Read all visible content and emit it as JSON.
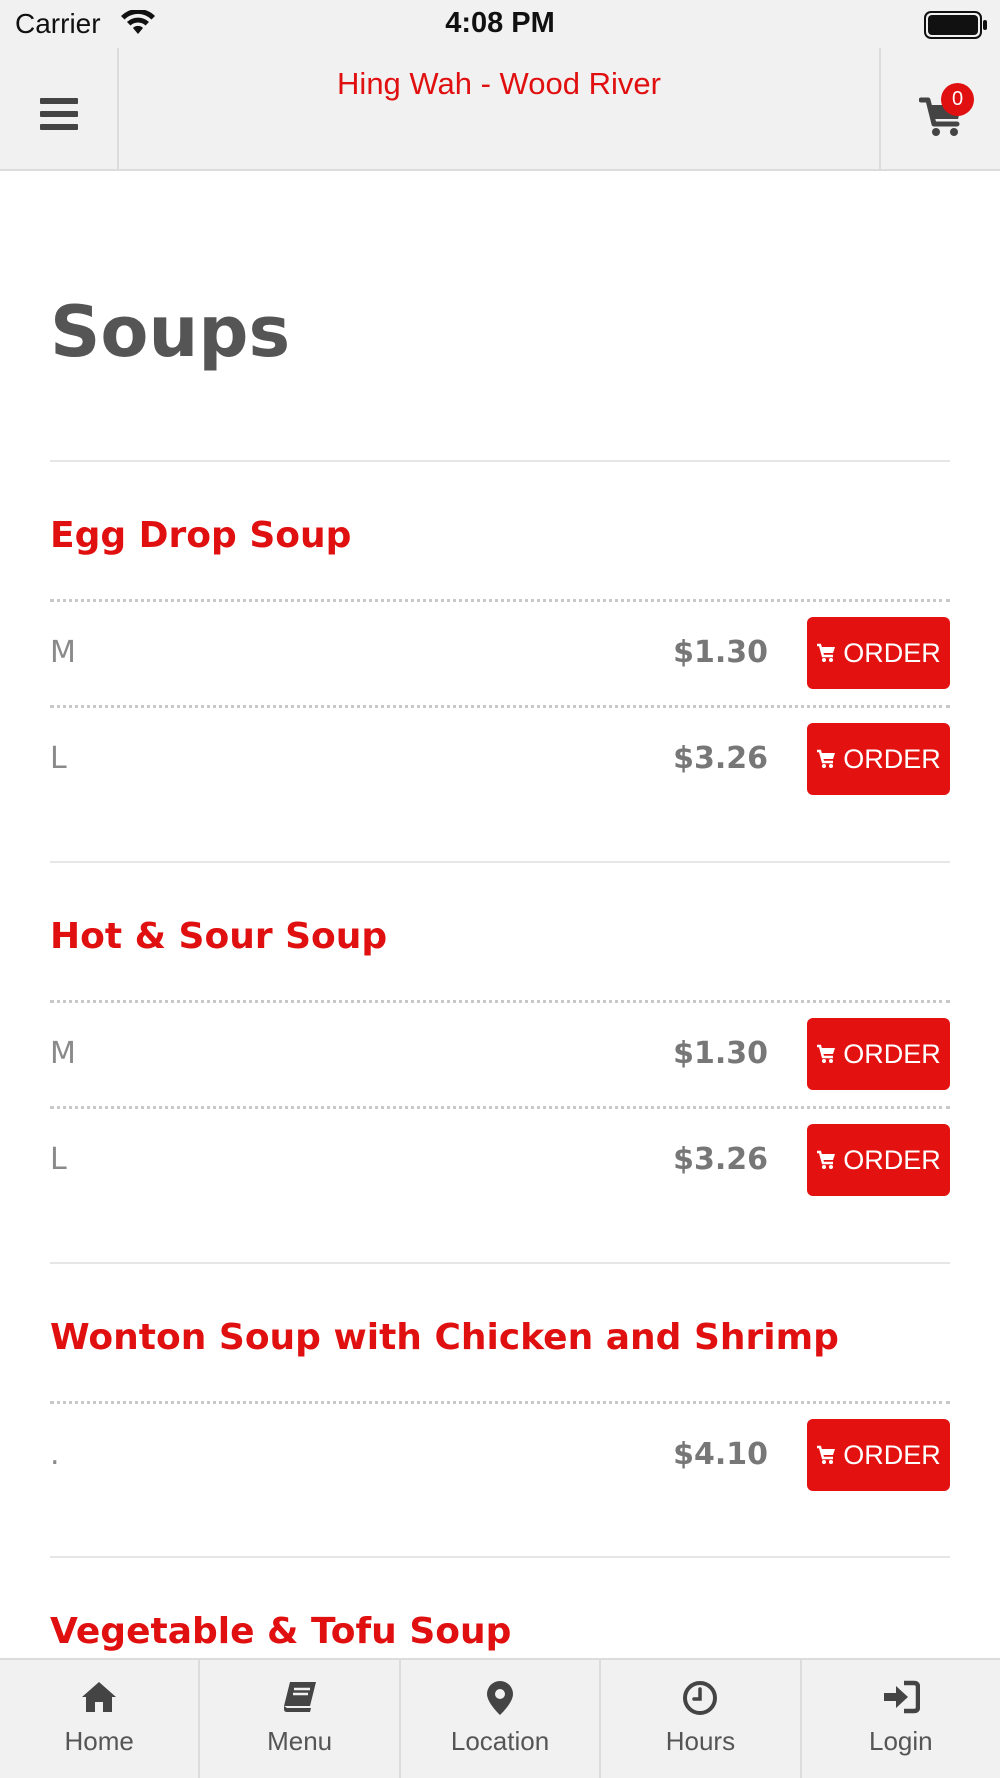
{
  "status_bar": {
    "carrier": "Carrier",
    "time": "4:08 PM"
  },
  "header": {
    "restaurant_name": "Hing Wah - Wood River",
    "cart_count": "0",
    "menu_icon": "hamburger-menu-icon",
    "cart_icon": "shopping-cart-icon"
  },
  "page": {
    "title": "Soups"
  },
  "items": [
    {
      "name": "Egg Drop Soup",
      "options": [
        {
          "size": "M",
          "price": "$1.30",
          "button": "ORDER"
        },
        {
          "size": "L",
          "price": "$3.26",
          "button": "ORDER"
        }
      ]
    },
    {
      "name": "Hot & Sour Soup",
      "options": [
        {
          "size": "M",
          "price": "$1.30",
          "button": "ORDER"
        },
        {
          "size": "L",
          "price": "$3.26",
          "button": "ORDER"
        }
      ]
    },
    {
      "name": "Wonton Soup with Chicken and Shrimp",
      "options": [
        {
          "size": ".",
          "price": "$4.10",
          "button": "ORDER"
        }
      ]
    },
    {
      "name": "Vegetable & Tofu Soup",
      "options": []
    }
  ],
  "tabs": [
    {
      "label": "Home",
      "icon": "home-icon"
    },
    {
      "label": "Menu",
      "icon": "book-icon"
    },
    {
      "label": "Location",
      "icon": "map-pin-icon"
    },
    {
      "label": "Hours",
      "icon": "clock-icon"
    },
    {
      "label": "Login",
      "icon": "sign-in-icon"
    }
  ],
  "colors": {
    "accent": "#e01010",
    "button": "#e41111",
    "bar_background": "#f1f1f1",
    "heading": "#555555"
  }
}
